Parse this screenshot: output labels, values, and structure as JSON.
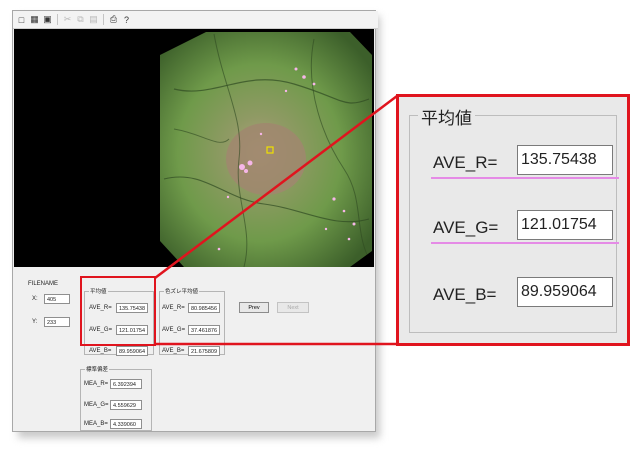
{
  "toolbar": {
    "icons": [
      "new-file-icon",
      "open-folder-icon",
      "save-icon",
      "cut-icon",
      "copy-icon",
      "paste-icon",
      "print-icon",
      "help-icon"
    ]
  },
  "form": {
    "filename_label": "FILENAME",
    "x_label": "X:",
    "x_value": "405",
    "y_label": "Y:",
    "y_value": "233",
    "avg": {
      "title": "平均値",
      "r_label": "AVE_R=",
      "r_value": "135.75438",
      "g_label": "AVE_G=",
      "g_value": "121.01754",
      "b_label": "AVE_B=",
      "b_value": "89.959064"
    },
    "avg2": {
      "title": "色ズレ平均値",
      "r_label": "AVE_R=",
      "r_value": "80.985456",
      "g_label": "AVE_G=",
      "g_value": "37.461876",
      "b_label": "AVE_B=",
      "b_value": "21.675809"
    },
    "std": {
      "title": "標準偏差",
      "r_label": "MEA_R=",
      "r_value": "6.392394",
      "g_label": "MEA_G=",
      "g_value": "4.559629",
      "b_label": "MEA_B=",
      "b_value": "4.339060"
    },
    "prev_label": "Prev",
    "next_label": "Next"
  },
  "zoom": {
    "title": "平均値",
    "r_label": "AVE_R=",
    "r_value": "135.75438",
    "g_label": "AVE_G=",
    "g_value": "121.01754",
    "b_label": "AVE_B=",
    "b_value": "89.959064"
  },
  "colors": {
    "highlight": "#e0141e",
    "underline": "#e58be6",
    "tissue": "#6f9a4a"
  }
}
